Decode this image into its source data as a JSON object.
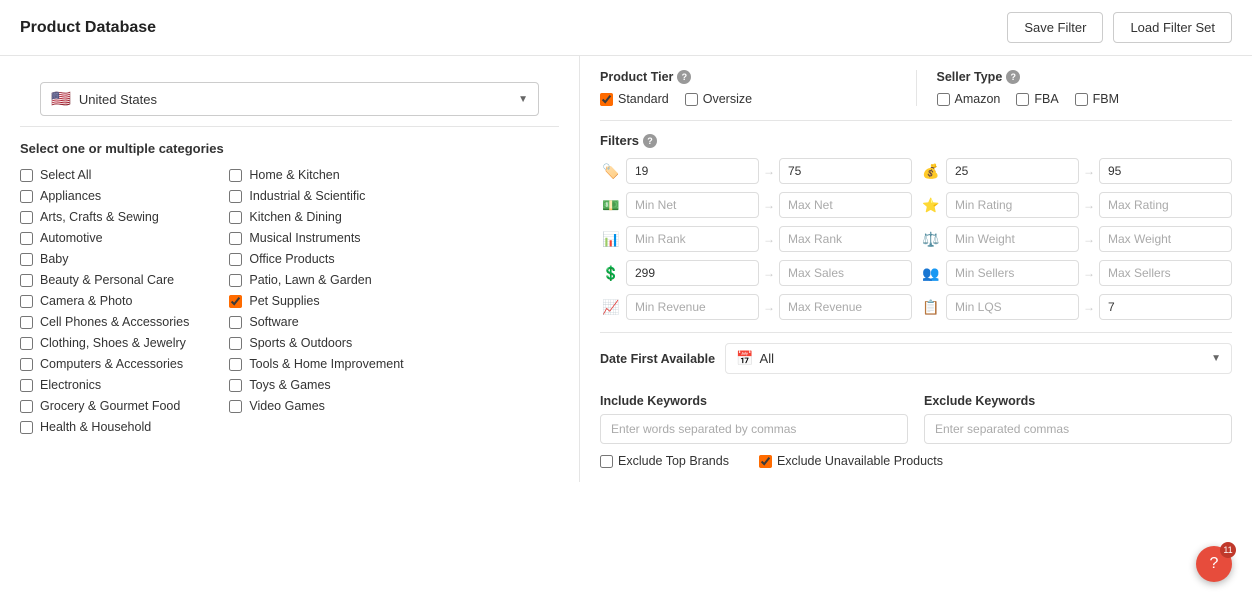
{
  "header": {
    "title": "Product Database",
    "save_filter_label": "Save Filter",
    "load_filter_label": "Load Filter Set"
  },
  "country": {
    "name": "United States",
    "flag": "🇺🇸"
  },
  "categories": {
    "section_title": "Select one or multiple categories",
    "col1": [
      {
        "label": "Select All",
        "checked": false
      },
      {
        "label": "Appliances",
        "checked": false
      },
      {
        "label": "Arts, Crafts & Sewing",
        "checked": false
      },
      {
        "label": "Automotive",
        "checked": false
      },
      {
        "label": "Baby",
        "checked": false
      },
      {
        "label": "Beauty & Personal Care",
        "checked": false
      },
      {
        "label": "Camera & Photo",
        "checked": false
      },
      {
        "label": "Cell Phones & Accessories",
        "checked": false
      },
      {
        "label": "Clothing, Shoes & Jewelry",
        "checked": false
      },
      {
        "label": "Computers & Accessories",
        "checked": false
      },
      {
        "label": "Electronics",
        "checked": false
      },
      {
        "label": "Grocery & Gourmet Food",
        "checked": false
      },
      {
        "label": "Health & Household",
        "checked": false
      }
    ],
    "col2": [
      {
        "label": "Home & Kitchen",
        "checked": false
      },
      {
        "label": "Industrial & Scientific",
        "checked": false
      },
      {
        "label": "Kitchen & Dining",
        "checked": false
      },
      {
        "label": "Musical Instruments",
        "checked": false
      },
      {
        "label": "Office Products",
        "checked": false
      },
      {
        "label": "Patio, Lawn & Garden",
        "checked": false
      },
      {
        "label": "Pet Supplies",
        "checked": true
      },
      {
        "label": "Software",
        "checked": false
      },
      {
        "label": "Sports & Outdoors",
        "checked": false
      },
      {
        "label": "Tools & Home Improvement",
        "checked": false
      },
      {
        "label": "Toys & Games",
        "checked": false
      },
      {
        "label": "Video Games",
        "checked": false
      }
    ]
  },
  "product_tier": {
    "title": "Product Tier",
    "options": [
      {
        "label": "Standard",
        "checked": true
      },
      {
        "label": "Oversize",
        "checked": false
      }
    ]
  },
  "seller_type": {
    "title": "Seller Type",
    "options": [
      {
        "label": "Amazon",
        "checked": false
      },
      {
        "label": "FBA",
        "checked": false
      },
      {
        "label": "FBM",
        "checked": false
      }
    ]
  },
  "filters": {
    "title": "Filters",
    "rows": [
      {
        "left": {
          "icon": "price-tag",
          "min_val": "19",
          "min_placeholder": "",
          "max_val": "75",
          "max_placeholder": ""
        },
        "right": {
          "icon": "price-tag-2",
          "min_val": "25",
          "min_placeholder": "",
          "max_val": "95",
          "max_placeholder": ""
        }
      },
      {
        "left": {
          "icon": "dollar",
          "min_val": "",
          "min_placeholder": "Min Net",
          "max_val": "",
          "max_placeholder": "Max Net"
        },
        "right": {
          "icon": "star",
          "min_val": "",
          "min_placeholder": "Min Rating",
          "max_val": "",
          "max_placeholder": "Max Rating"
        }
      },
      {
        "left": {
          "icon": "rank",
          "min_val": "",
          "min_placeholder": "Min Rank",
          "max_val": "",
          "max_placeholder": "Max Rank"
        },
        "right": {
          "icon": "weight",
          "min_val": "",
          "min_placeholder": "Min Weight",
          "max_val": "",
          "max_placeholder": "Max Weight"
        }
      },
      {
        "left": {
          "icon": "sales",
          "min_val": "299",
          "min_placeholder": "",
          "max_val": "",
          "max_placeholder": "Max Sales"
        },
        "right": {
          "icon": "sellers",
          "min_val": "",
          "min_placeholder": "Min Sellers",
          "max_val": "",
          "max_placeholder": "Max Sellers"
        }
      },
      {
        "left": {
          "icon": "revenue",
          "min_val": "",
          "min_placeholder": "Min Revenue",
          "max_val": "",
          "max_placeholder": "Max Revenue"
        },
        "right": {
          "icon": "lqs",
          "min_val": "",
          "min_placeholder": "Min LQS",
          "max_val": "7",
          "max_placeholder": ""
        }
      }
    ]
  },
  "date_first_available": {
    "label": "Date First Available",
    "value": "All"
  },
  "keywords": {
    "include": {
      "label": "Include Keywords",
      "placeholder": "Enter words separated by commas"
    },
    "exclude": {
      "label": "Exclude Keywords",
      "placeholder": "Enter separated commas"
    }
  },
  "bottom_options": {
    "exclude_top_brands": {
      "label": "Exclude Top Brands",
      "checked": false
    },
    "exclude_unavailable": {
      "label": "Exclude Unavailable Products",
      "checked": true
    }
  },
  "help": {
    "count": "11",
    "symbol": "?"
  }
}
